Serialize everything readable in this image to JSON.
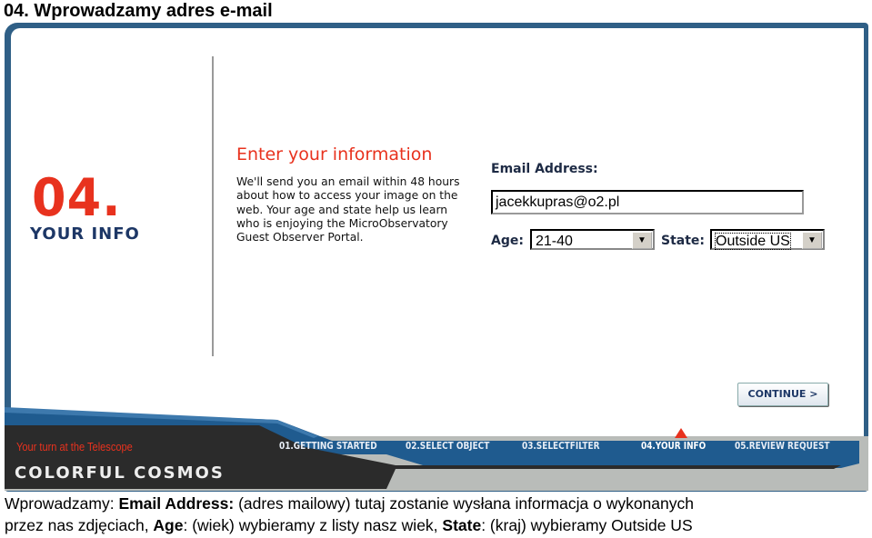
{
  "title": "04. Wprowadzamy adres e-mail",
  "step": {
    "number": "04.",
    "label": "YOUR INFO"
  },
  "form": {
    "heading": "Enter your information",
    "description": "We'll send you an email within 48 hours about how to access your image on the web. Your age and state help us learn who is enjoying the MicroObservatory Guest Observer Portal.",
    "email_label": "Email Address:",
    "email_value": "jacekkupras@o2.pl",
    "age_label": "Age:",
    "age_value": "21-40",
    "state_label": "State:",
    "state_value": "Outside US",
    "continue_label": "CONTINUE >"
  },
  "footer": {
    "tagline": "Your turn at the Telescope",
    "brand": "COLORFUL COSMOS",
    "nav": [
      "01.GETTING STARTED",
      "02.SELECT OBJECT",
      "03.SELECTFILTER",
      "04.YOUR INFO",
      "05.REVIEW REQUEST"
    ],
    "active_index": 3
  },
  "caption": {
    "l1a": "Wprowadzamy: ",
    "l1b": "Email Address:",
    "l1c": " (adres mailowy) tutaj zostanie wysłana informacja o wykonanych",
    "l2a": "przez nas zdjęciach, ",
    "l2b": "Age",
    "l2c": ": (wiek) wybieramy z listy nasz wiek, ",
    "l2d": "State",
    "l2e": ": (kraj) wybieramy Outside US"
  },
  "colors": {
    "accent": "#e8321e",
    "frame": "#2f5f86",
    "navy": "#1d3766"
  }
}
